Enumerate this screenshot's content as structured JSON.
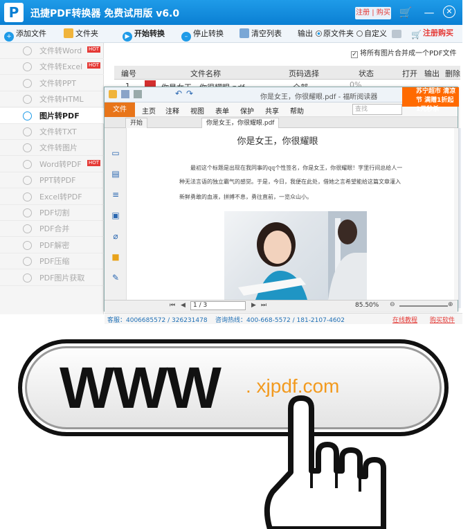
{
  "window": {
    "title": "迅捷PDF转换器 免费试用版 v6.0",
    "register": "注册 | 购买"
  },
  "toolbar": {
    "add_file": "添加文件",
    "folder": "文件夹",
    "start": "开始转换",
    "stop": "停止转换",
    "clear": "清空列表",
    "output_label": "输出",
    "opt_original": "原文件夹",
    "opt_custom": "自定义",
    "buy": "注册购买"
  },
  "sidebar": {
    "items": [
      {
        "label": "文件转Word",
        "hot": true
      },
      {
        "label": "文件转Excel",
        "hot": true
      },
      {
        "label": "文件转PPT",
        "hot": false
      },
      {
        "label": "文件转HTML",
        "hot": false
      },
      {
        "label": "图片转PDF",
        "hot": false,
        "active": true
      },
      {
        "label": "文件转TXT",
        "hot": false
      },
      {
        "label": "文件转图片",
        "hot": false
      },
      {
        "label": "Word转PDF",
        "hot": true
      },
      {
        "label": "PPT转PDF",
        "hot": false
      },
      {
        "label": "Excel转PDF",
        "hot": false
      },
      {
        "label": "PDF切割",
        "hot": false
      },
      {
        "label": "PDF合并",
        "hot": false
      },
      {
        "label": "PDF解密",
        "hot": false
      },
      {
        "label": "PDF压缩",
        "hot": false
      },
      {
        "label": "PDF图片获取",
        "hot": false
      }
    ],
    "hot_label": "HOT"
  },
  "main": {
    "merge_option": "将所有图片合并成一个PDF文件",
    "columns": [
      "编号",
      "文件名称",
      "页码选择",
      "状态",
      "打开",
      "输出",
      "删除"
    ],
    "row": {
      "num": "1",
      "name": "你是女王，你很耀眼.pdf",
      "pages": "全部",
      "status": "0%"
    }
  },
  "reader": {
    "window_title": "你是女王，你很耀眼.pdf - 福昕阅读器",
    "menu": [
      "文件",
      "主页",
      "注释",
      "视图",
      "表单",
      "保护",
      "共享",
      "帮助"
    ],
    "search_placeholder": "查找",
    "promo": "苏宁超市 清凉节 满赠1折起 1元秒杀",
    "tabs": [
      "开始",
      "你是女王，你很耀眼.pdf"
    ],
    "doc_title": "你是女王，你很耀眼",
    "doc_lines": [
      "最初这个标题是出现在我同事的qq个性签名，你是女王，你很耀眼！字里行间总给人一",
      "种无法言语的独立霸气的感觉。于是，今日，我便在此处，借她之言希望能给这篇文章灌入",
      "新鲜勇敢的血液，拼搏不息，勇往直前，一览众山小。"
    ],
    "page_indicator": "1 / 3",
    "zoom": "85.50%"
  },
  "footer": {
    "support": "客服：4006685572 / 326231478",
    "hotline": "咨询热线：400-668-5572 / 181-2107-4602",
    "tutorial": "在线教程",
    "buy": "购买软件"
  },
  "banner": {
    "www": "WWW",
    "url": ". xjpdf.com"
  },
  "colors": {
    "titlebar": "#1f9be8",
    "accent_orange": "#e8751a",
    "hot_red": "#e53935",
    "url_orange": "#f29a1f"
  }
}
